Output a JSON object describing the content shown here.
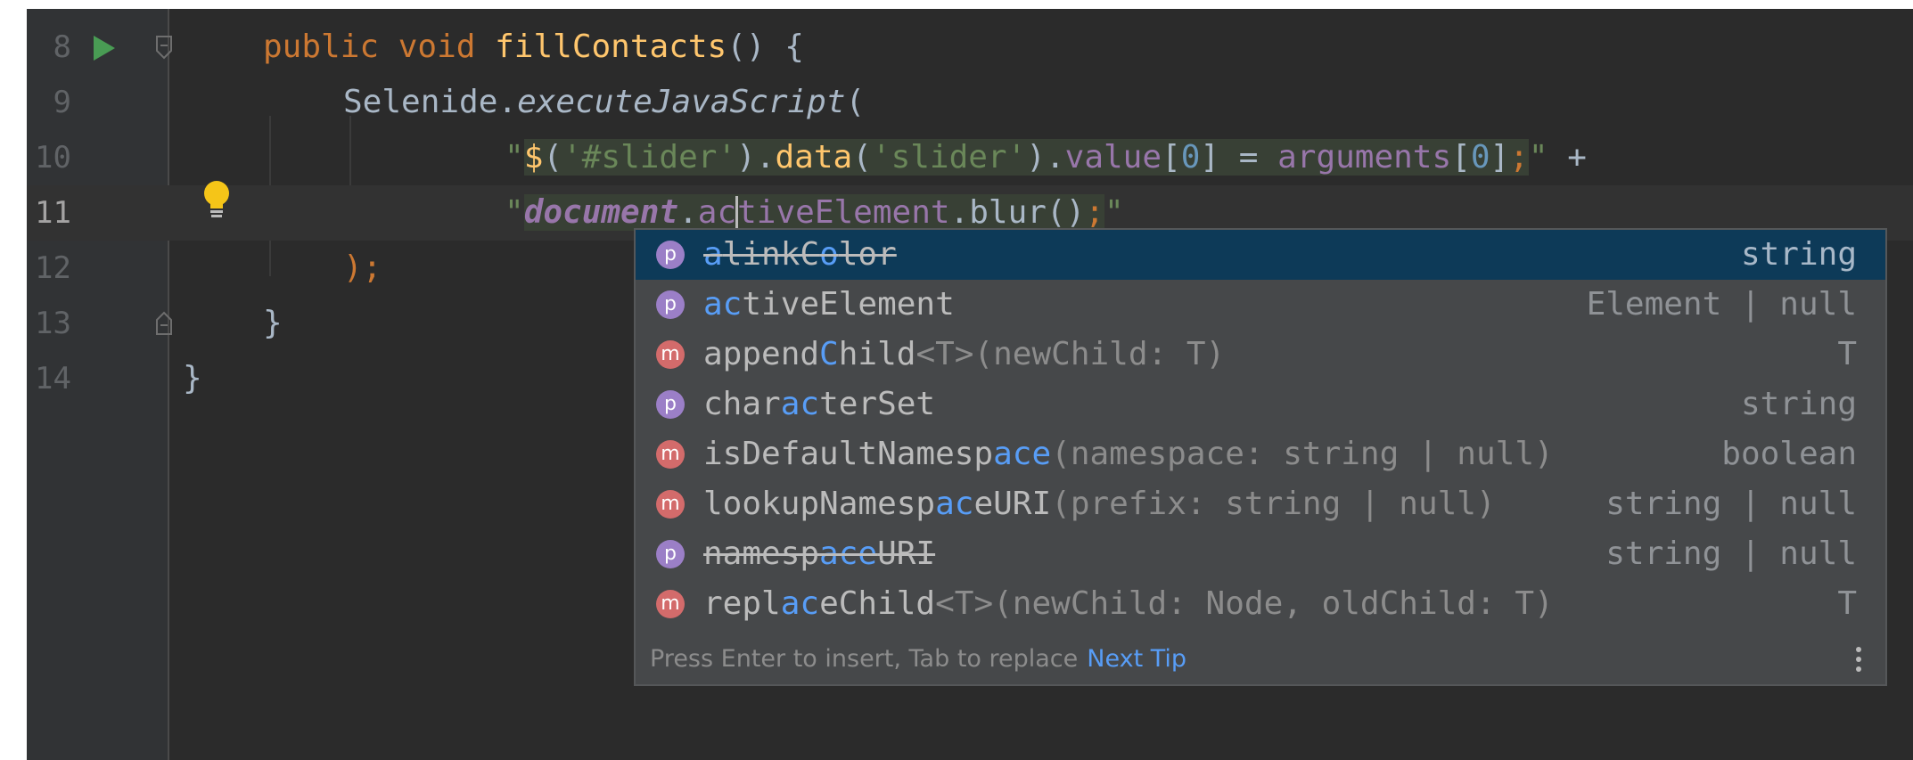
{
  "editor": {
    "lines": [
      {
        "n": "8",
        "kw1": "public",
        "kw2": "void",
        "name": "fillContacts",
        "rest": "() {"
      },
      {
        "n": "9",
        "cls": "Selenide.",
        "method": "executeJavaScript",
        "paren": "("
      },
      {
        "n": "10",
        "q1": "\"",
        "dollar": "$",
        "p1": "(",
        "s1": "'#slider'",
        "p2": ").",
        "f1": "data",
        "p3": "(",
        "s2": "'slider'",
        "p4": ").",
        "prop": "value",
        "b1": "[",
        "num1": "0",
        "b2": "] = ",
        "args": "arguments",
        "b3": "[",
        "num2": "0",
        "b4": "]",
        "semi": ";",
        "q2": "\"",
        "plus": " +"
      },
      {
        "n": "11",
        "q1": "\"",
        "doc": "document",
        "dot": ".",
        "typed_before": "ac",
        "typed_after": "tiveElement",
        "rest": ".blur()",
        "semi": ";",
        "q2": "\""
      },
      {
        "n": "12",
        "text": ");"
      },
      {
        "n": "13",
        "text": "}"
      },
      {
        "n": "14",
        "text": "}"
      }
    ]
  },
  "completion": {
    "items": [
      {
        "badge": "p",
        "parts": [
          "a",
          "linkC",
          "o",
          "lor"
        ],
        "sig": "",
        "type": "string",
        "strike": true,
        "selected": true
      },
      {
        "badge": "p",
        "parts": [
          "ac",
          "tiveElement"
        ],
        "sig": "",
        "type": "Element | null",
        "strike": false,
        "selected": false
      },
      {
        "badge": "m",
        "parts": [
          "append",
          "C",
          "hild"
        ],
        "sig": "<T>(newChild: T)",
        "type": "T",
        "strike": false,
        "selected": false
      },
      {
        "badge": "p",
        "parts": [
          "char",
          "ac",
          "terSet"
        ],
        "sig": "",
        "type": "string",
        "strike": false,
        "selected": false
      },
      {
        "badge": "m",
        "parts": [
          "isDefaultNamesp",
          "ace"
        ],
        "sig": "(namespace: string | null)",
        "type": "boolean",
        "strike": false,
        "selected": false
      },
      {
        "badge": "m",
        "parts": [
          "lookupNamesp",
          "ac",
          "eURI"
        ],
        "sig": "(prefix: string | null)",
        "type": "string | null",
        "strike": false,
        "selected": false
      },
      {
        "badge": "p",
        "parts": [
          "namesp",
          "ace",
          "URI"
        ],
        "sig": "",
        "type": "string | null",
        "strike": true,
        "selected": false
      },
      {
        "badge": "m",
        "parts": [
          "repl",
          "ac",
          "eChild"
        ],
        "sig": "<T>(newChild: Node, oldChild: T)",
        "type": "T",
        "strike": false,
        "selected": false
      }
    ],
    "footer_hint": "Press Enter to insert, Tab to replace",
    "footer_link": "Next Tip",
    "more_icon": "kebab-menu-icon"
  },
  "colors": {
    "background": "#2b2b2b",
    "gutter": "#313335",
    "keyword": "#cc7832",
    "function": "#ffc66d",
    "string": "#6a8759",
    "property": "#9876aa",
    "number": "#6897bb",
    "match_highlight": "#589df6",
    "selection": "#0d3a58"
  }
}
